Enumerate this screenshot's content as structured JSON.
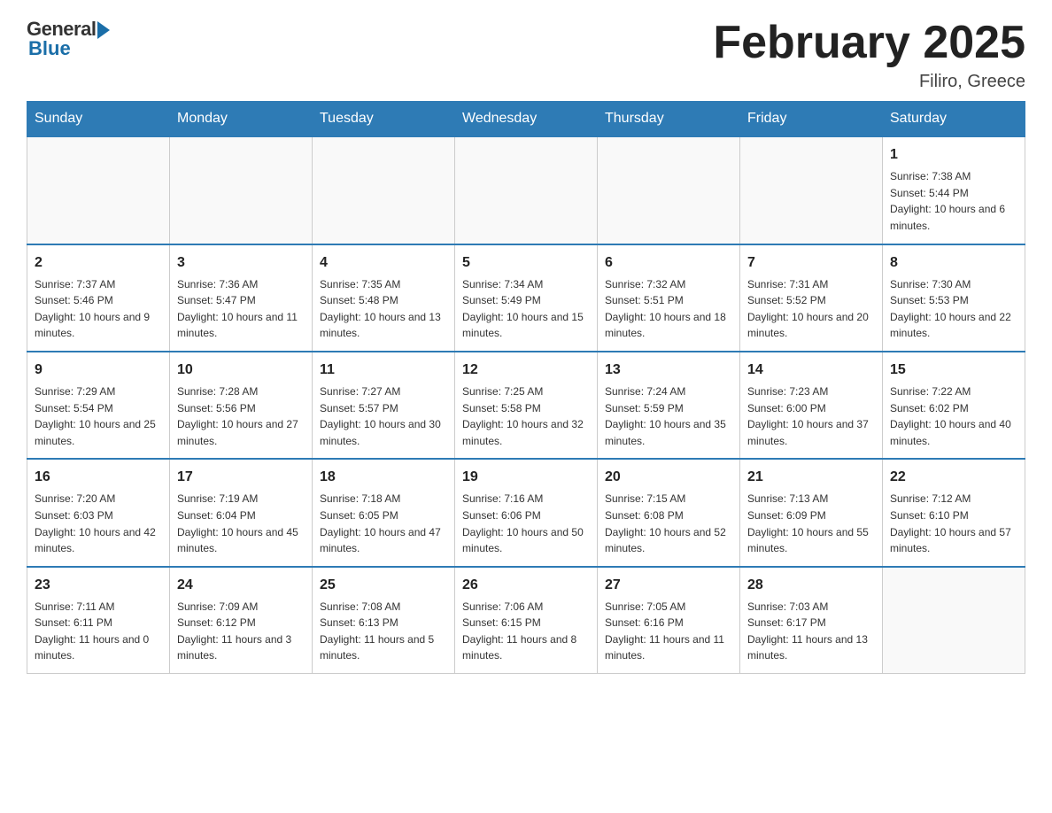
{
  "header": {
    "logo_general": "General",
    "logo_blue": "Blue",
    "title": "February 2025",
    "location": "Filiro, Greece"
  },
  "weekdays": [
    "Sunday",
    "Monday",
    "Tuesday",
    "Wednesday",
    "Thursday",
    "Friday",
    "Saturday"
  ],
  "weeks": [
    [
      {
        "day": "",
        "info": ""
      },
      {
        "day": "",
        "info": ""
      },
      {
        "day": "",
        "info": ""
      },
      {
        "day": "",
        "info": ""
      },
      {
        "day": "",
        "info": ""
      },
      {
        "day": "",
        "info": ""
      },
      {
        "day": "1",
        "info": "Sunrise: 7:38 AM\nSunset: 5:44 PM\nDaylight: 10 hours and 6 minutes."
      }
    ],
    [
      {
        "day": "2",
        "info": "Sunrise: 7:37 AM\nSunset: 5:46 PM\nDaylight: 10 hours and 9 minutes."
      },
      {
        "day": "3",
        "info": "Sunrise: 7:36 AM\nSunset: 5:47 PM\nDaylight: 10 hours and 11 minutes."
      },
      {
        "day": "4",
        "info": "Sunrise: 7:35 AM\nSunset: 5:48 PM\nDaylight: 10 hours and 13 minutes."
      },
      {
        "day": "5",
        "info": "Sunrise: 7:34 AM\nSunset: 5:49 PM\nDaylight: 10 hours and 15 minutes."
      },
      {
        "day": "6",
        "info": "Sunrise: 7:32 AM\nSunset: 5:51 PM\nDaylight: 10 hours and 18 minutes."
      },
      {
        "day": "7",
        "info": "Sunrise: 7:31 AM\nSunset: 5:52 PM\nDaylight: 10 hours and 20 minutes."
      },
      {
        "day": "8",
        "info": "Sunrise: 7:30 AM\nSunset: 5:53 PM\nDaylight: 10 hours and 22 minutes."
      }
    ],
    [
      {
        "day": "9",
        "info": "Sunrise: 7:29 AM\nSunset: 5:54 PM\nDaylight: 10 hours and 25 minutes."
      },
      {
        "day": "10",
        "info": "Sunrise: 7:28 AM\nSunset: 5:56 PM\nDaylight: 10 hours and 27 minutes."
      },
      {
        "day": "11",
        "info": "Sunrise: 7:27 AM\nSunset: 5:57 PM\nDaylight: 10 hours and 30 minutes."
      },
      {
        "day": "12",
        "info": "Sunrise: 7:25 AM\nSunset: 5:58 PM\nDaylight: 10 hours and 32 minutes."
      },
      {
        "day": "13",
        "info": "Sunrise: 7:24 AM\nSunset: 5:59 PM\nDaylight: 10 hours and 35 minutes."
      },
      {
        "day": "14",
        "info": "Sunrise: 7:23 AM\nSunset: 6:00 PM\nDaylight: 10 hours and 37 minutes."
      },
      {
        "day": "15",
        "info": "Sunrise: 7:22 AM\nSunset: 6:02 PM\nDaylight: 10 hours and 40 minutes."
      }
    ],
    [
      {
        "day": "16",
        "info": "Sunrise: 7:20 AM\nSunset: 6:03 PM\nDaylight: 10 hours and 42 minutes."
      },
      {
        "day": "17",
        "info": "Sunrise: 7:19 AM\nSunset: 6:04 PM\nDaylight: 10 hours and 45 minutes."
      },
      {
        "day": "18",
        "info": "Sunrise: 7:18 AM\nSunset: 6:05 PM\nDaylight: 10 hours and 47 minutes."
      },
      {
        "day": "19",
        "info": "Sunrise: 7:16 AM\nSunset: 6:06 PM\nDaylight: 10 hours and 50 minutes."
      },
      {
        "day": "20",
        "info": "Sunrise: 7:15 AM\nSunset: 6:08 PM\nDaylight: 10 hours and 52 minutes."
      },
      {
        "day": "21",
        "info": "Sunrise: 7:13 AM\nSunset: 6:09 PM\nDaylight: 10 hours and 55 minutes."
      },
      {
        "day": "22",
        "info": "Sunrise: 7:12 AM\nSunset: 6:10 PM\nDaylight: 10 hours and 57 minutes."
      }
    ],
    [
      {
        "day": "23",
        "info": "Sunrise: 7:11 AM\nSunset: 6:11 PM\nDaylight: 11 hours and 0 minutes."
      },
      {
        "day": "24",
        "info": "Sunrise: 7:09 AM\nSunset: 6:12 PM\nDaylight: 11 hours and 3 minutes."
      },
      {
        "day": "25",
        "info": "Sunrise: 7:08 AM\nSunset: 6:13 PM\nDaylight: 11 hours and 5 minutes."
      },
      {
        "day": "26",
        "info": "Sunrise: 7:06 AM\nSunset: 6:15 PM\nDaylight: 11 hours and 8 minutes."
      },
      {
        "day": "27",
        "info": "Sunrise: 7:05 AM\nSunset: 6:16 PM\nDaylight: 11 hours and 11 minutes."
      },
      {
        "day": "28",
        "info": "Sunrise: 7:03 AM\nSunset: 6:17 PM\nDaylight: 11 hours and 13 minutes."
      },
      {
        "day": "",
        "info": ""
      }
    ]
  ]
}
